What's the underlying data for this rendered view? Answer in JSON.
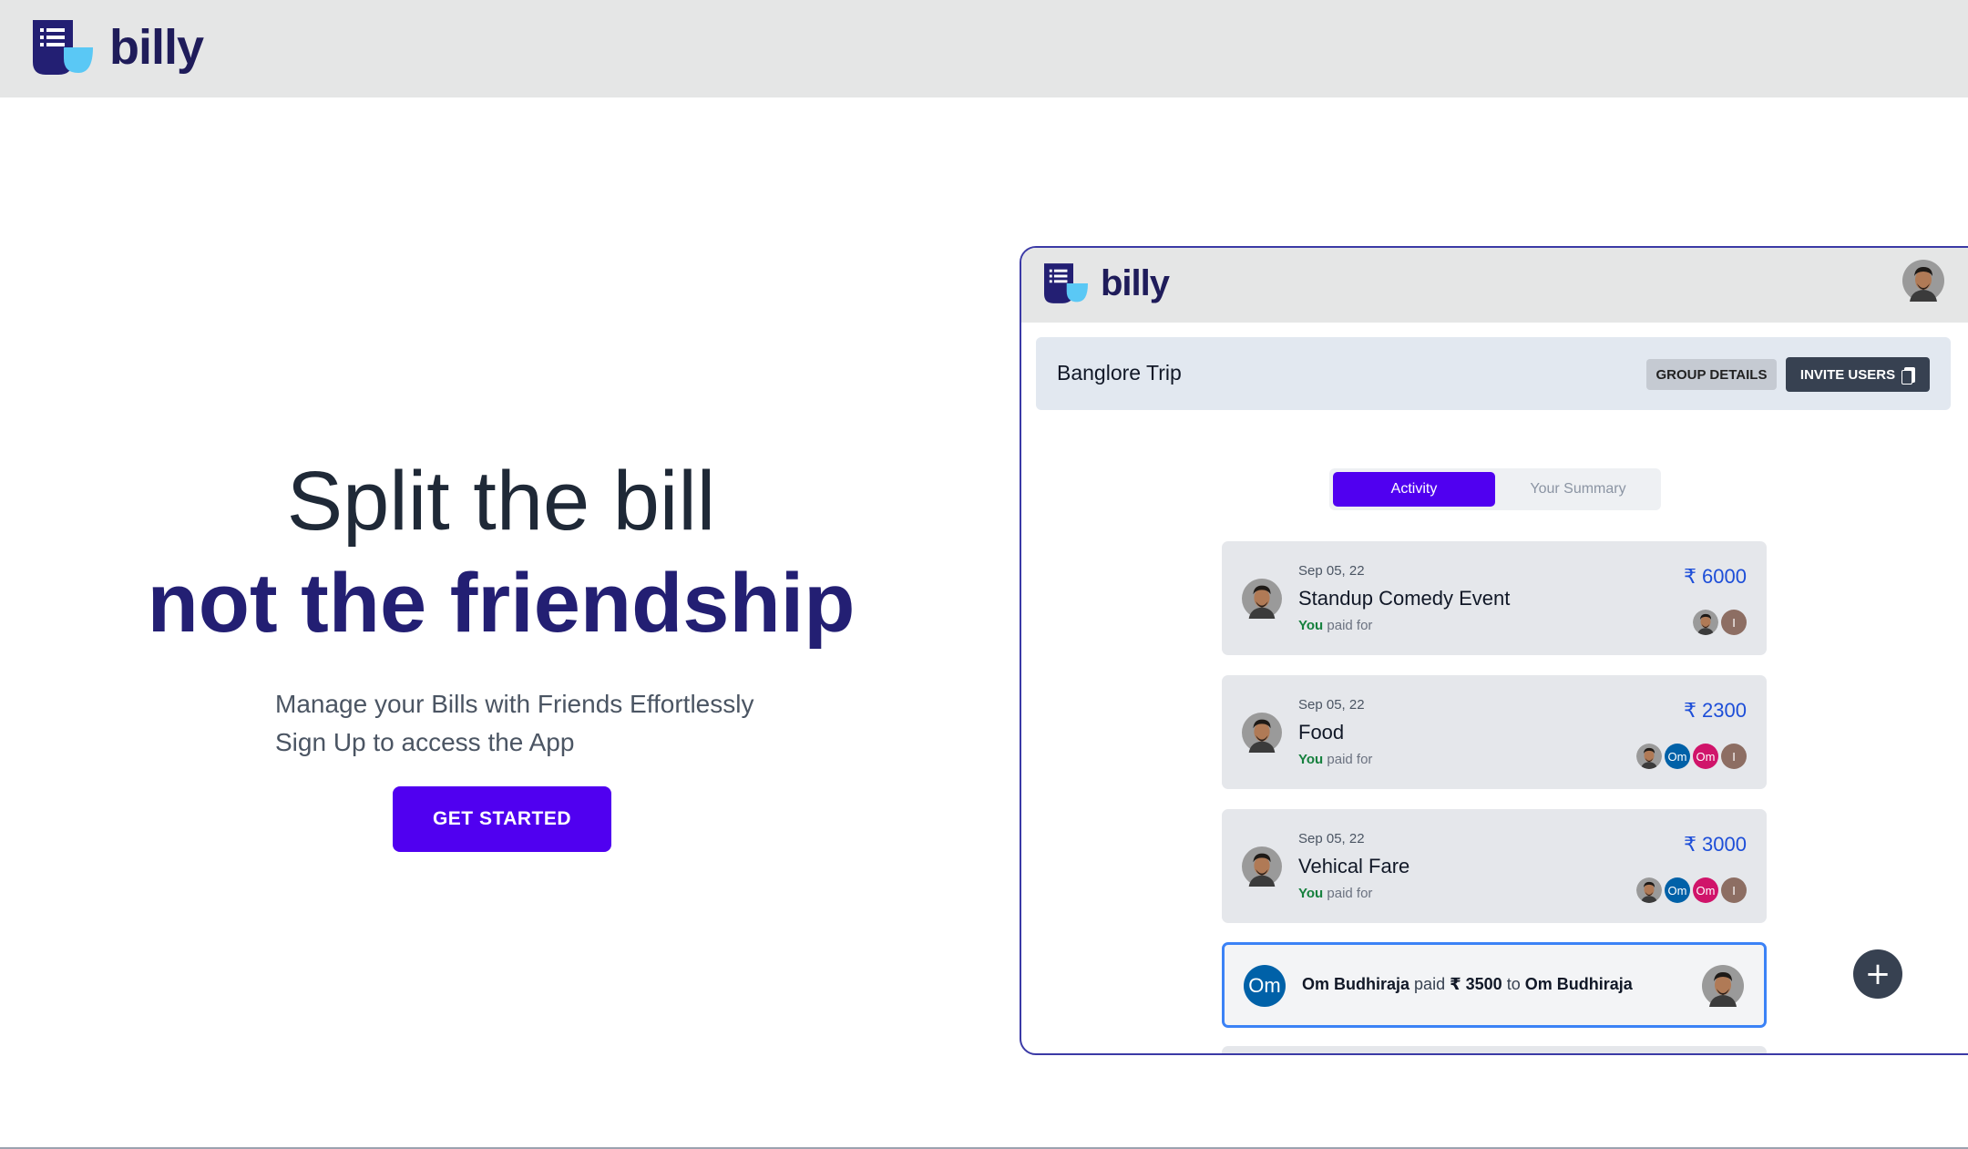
{
  "brand": {
    "name": "billy",
    "colors": {
      "primary": "#5000f0",
      "navy": "#231f73",
      "accent_light": "#5ac8f5"
    }
  },
  "hero": {
    "title_line1": "Split the bill",
    "title_line2": "not the friendship",
    "subtitle_line1": "Manage your Bills with Friends Effortlessly",
    "subtitle_line2": "Sign Up to access the App",
    "cta_label": "GET STARTED"
  },
  "preview": {
    "app_name": "billy",
    "group": {
      "name": "Banglore Trip",
      "details_label": "GROUP DETAILS",
      "invite_label": "INVITE USERS"
    },
    "tabs": [
      {
        "label": "Activity",
        "active": true
      },
      {
        "label": "Your Summary",
        "active": false
      }
    ],
    "expenses": [
      {
        "date": "Sep 05, 22",
        "title": "Standup Comedy Event",
        "payer": "You",
        "paid_text": "paid for",
        "amount": "₹ 6000",
        "participants": [
          "photo",
          "I"
        ]
      },
      {
        "date": "Sep 05, 22",
        "title": "Food",
        "payer": "You",
        "paid_text": "paid for",
        "amount": "₹ 2300",
        "participants": [
          "photo",
          "Om",
          "Om",
          "I"
        ]
      },
      {
        "date": "Sep 05, 22",
        "title": "Vehical Fare",
        "payer": "You",
        "paid_text": "paid for",
        "amount": "₹ 3000",
        "participants": [
          "photo",
          "Om",
          "Om",
          "I"
        ]
      }
    ],
    "settlement": {
      "avatar": "Om",
      "from": "Om Budhiraja",
      "verb": "paid",
      "amount": "₹ 3500",
      "to_word": "to",
      "to": "Om Budhiraja"
    },
    "fab_label": "+"
  }
}
